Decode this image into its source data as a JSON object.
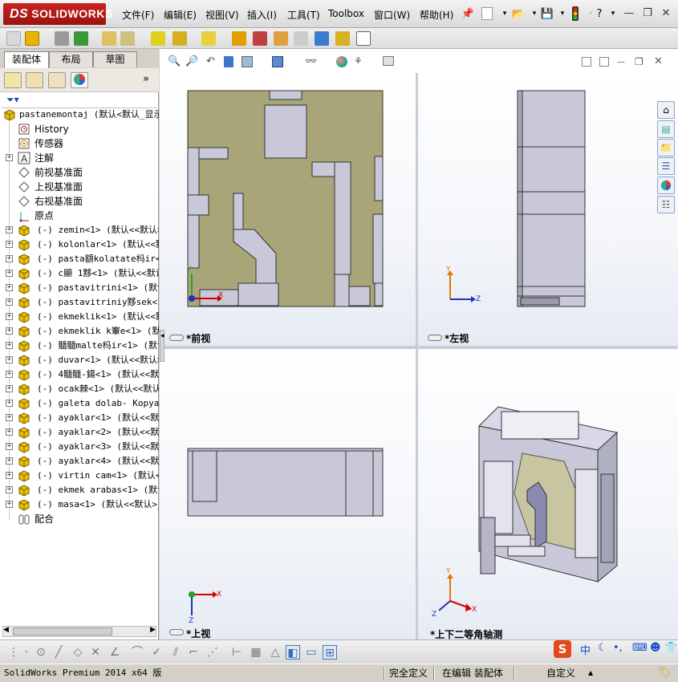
{
  "app": {
    "brand": "SOLIDWORKS",
    "brand_prefix": "DS"
  },
  "menu": [
    "文件(F)",
    "编辑(E)",
    "视图(V)",
    "插入(I)",
    "工具(T)",
    "Toolbox",
    "窗口(W)",
    "帮助(H)"
  ],
  "left_panel": {
    "tabs": [
      "装配体",
      "布局",
      "草图"
    ],
    "root": "pastanemontaj  (默认<默认_显示",
    "items": [
      {
        "label": "History",
        "kind": "history",
        "expand": false
      },
      {
        "label": "传感器",
        "kind": "sensor",
        "expand": false
      },
      {
        "label": "注解",
        "kind": "annotation",
        "expand": true
      },
      {
        "label": "前视基准面",
        "kind": "plane",
        "expand": false
      },
      {
        "label": "上视基准面",
        "kind": "plane",
        "expand": false
      },
      {
        "label": "右视基准面",
        "kind": "plane",
        "expand": false
      },
      {
        "label": "原点",
        "kind": "origin",
        "expand": false
      },
      {
        "label": "(-) zemin<1> (默认<<默认>_",
        "kind": "part",
        "expand": true
      },
      {
        "label": "(-) kolonlar<1> (默认<<默认",
        "kind": "part",
        "expand": true
      },
      {
        "label": "(-) pasta額kolatate杩ir<1>",
        "kind": "part",
        "expand": true
      },
      {
        "label": "(-) c顯 1黟<1> (默认<<默认",
        "kind": "part",
        "expand": true
      },
      {
        "label": "(-) pastavitrini<1> (默认<",
        "kind": "part",
        "expand": true
      },
      {
        "label": "(-) pastavitriniy黟sek<1>",
        "kind": "part",
        "expand": true
      },
      {
        "label": "(-) ekmeklik<1> (默认<<默认",
        "kind": "part",
        "expand": true
      },
      {
        "label": "(-) ekmeklik k輋e<1> (默认",
        "kind": "part",
        "expand": true
      },
      {
        "label": "(-) 髓髓malte杩ir<1> (默认",
        "kind": "part",
        "expand": true
      },
      {
        "label": "(-) duvar<1> (默认<<默认>_",
        "kind": "part",
        "expand": true
      },
      {
        "label": "(-) 4髓髓-鍚<1> (默认<<默",
        "kind": "part",
        "expand": true
      },
      {
        "label": "(-) ocak棘<1> (默认<<默认",
        "kind": "part",
        "expand": true
      },
      {
        "label": "(-) galeta dolab- Kopya<1",
        "kind": "part",
        "expand": true
      },
      {
        "label": "(-) ayaklar<1> (默认<<默认",
        "kind": "part",
        "expand": true
      },
      {
        "label": "(-) ayaklar<2> (默认<<默认",
        "kind": "part",
        "expand": true
      },
      {
        "label": "(-) ayaklar<3> (默认<<默认",
        "kind": "part",
        "expand": true
      },
      {
        "label": "(-) ayaklar<4> (默认<<默认",
        "kind": "part",
        "expand": true
      },
      {
        "label": "(-) virtin cam<1> (默认<<",
        "kind": "part",
        "expand": true
      },
      {
        "label": "(-) ekmek arabas<1> (默认",
        "kind": "part",
        "expand": true
      },
      {
        "label": "(-) masa<1> (默认<<默认>_显",
        "kind": "part",
        "expand": true
      },
      {
        "label": "配合",
        "kind": "mates",
        "expand": false
      }
    ]
  },
  "viewports": {
    "front": {
      "label": "*前视"
    },
    "left": {
      "label": "*左视"
    },
    "top": {
      "label": "*上视"
    },
    "iso": {
      "label": "*上下二等角轴测"
    }
  },
  "axes": {
    "x": "X",
    "y": "Y",
    "z": "Z"
  },
  "ime": {
    "mode": "中"
  },
  "statusbar": {
    "product": "SolidWorks Premium 2014 x64 版",
    "definition": "完全定义",
    "edit_state": "在编辑 装配体",
    "units": "自定义",
    "units_arrow": "▲"
  },
  "colors": {
    "floor": "#a8a578",
    "wall": "#c8c8d8",
    "brand_red": "#b31b17",
    "axis_x": "#d40000",
    "axis_y": "#e07800",
    "axis_z": "#2030c0"
  }
}
